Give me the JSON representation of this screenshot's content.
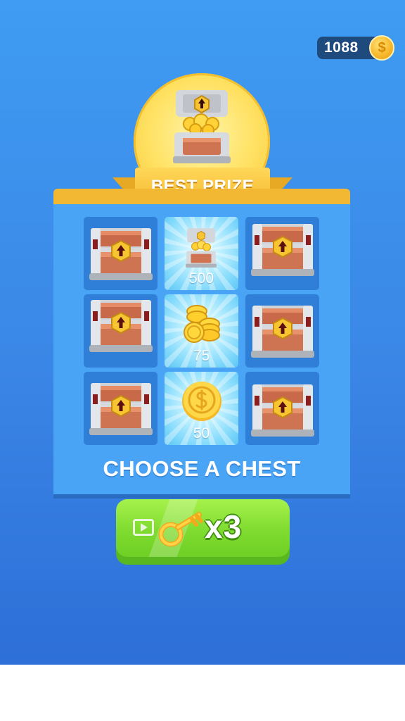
{
  "hud": {
    "coins": "1088",
    "coin_symbol": "$"
  },
  "best_prize": {
    "label": "BEST PRIZE"
  },
  "grid": {
    "rewards": [
      {
        "type": "chest",
        "value": "500"
      },
      {
        "type": "coin-stack",
        "value": "75"
      },
      {
        "type": "coin",
        "value": "50"
      }
    ]
  },
  "title": "CHOOSE A CHEST",
  "key_button": {
    "count": "x3",
    "icons": [
      "video-play-icon",
      "key-icon"
    ]
  },
  "colors": {
    "background_top": "#3f9cf2",
    "background_bottom": "#2d6fd7",
    "panel": "#4aa4f5",
    "chest_slot": "#2f7fd8",
    "ribbon": "#f4b92d",
    "button_green": "#7fdb2f"
  }
}
